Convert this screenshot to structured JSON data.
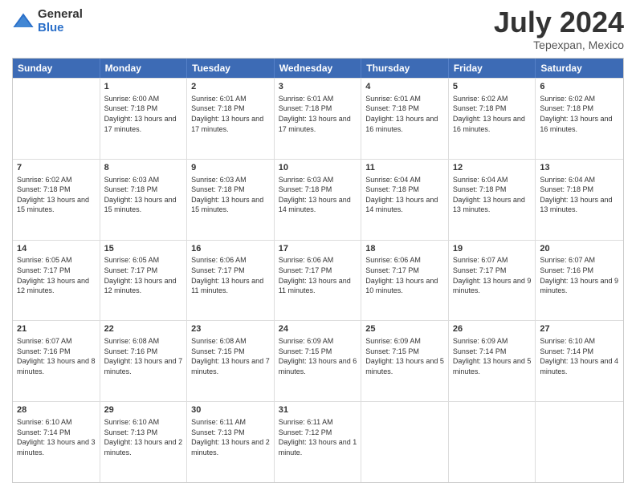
{
  "logo": {
    "general": "General",
    "blue": "Blue"
  },
  "title": "July 2024",
  "location": "Tepexpan, Mexico",
  "days_of_week": [
    "Sunday",
    "Monday",
    "Tuesday",
    "Wednesday",
    "Thursday",
    "Friday",
    "Saturday"
  ],
  "weeks": [
    [
      {
        "day": "",
        "sunrise": "",
        "sunset": "",
        "daylight": ""
      },
      {
        "day": "1",
        "sunrise": "Sunrise: 6:00 AM",
        "sunset": "Sunset: 7:18 PM",
        "daylight": "Daylight: 13 hours and 17 minutes."
      },
      {
        "day": "2",
        "sunrise": "Sunrise: 6:01 AM",
        "sunset": "Sunset: 7:18 PM",
        "daylight": "Daylight: 13 hours and 17 minutes."
      },
      {
        "day": "3",
        "sunrise": "Sunrise: 6:01 AM",
        "sunset": "Sunset: 7:18 PM",
        "daylight": "Daylight: 13 hours and 17 minutes."
      },
      {
        "day": "4",
        "sunrise": "Sunrise: 6:01 AM",
        "sunset": "Sunset: 7:18 PM",
        "daylight": "Daylight: 13 hours and 16 minutes."
      },
      {
        "day": "5",
        "sunrise": "Sunrise: 6:02 AM",
        "sunset": "Sunset: 7:18 PM",
        "daylight": "Daylight: 13 hours and 16 minutes."
      },
      {
        "day": "6",
        "sunrise": "Sunrise: 6:02 AM",
        "sunset": "Sunset: 7:18 PM",
        "daylight": "Daylight: 13 hours and 16 minutes."
      }
    ],
    [
      {
        "day": "7",
        "sunrise": "Sunrise: 6:02 AM",
        "sunset": "Sunset: 7:18 PM",
        "daylight": "Daylight: 13 hours and 15 minutes."
      },
      {
        "day": "8",
        "sunrise": "Sunrise: 6:03 AM",
        "sunset": "Sunset: 7:18 PM",
        "daylight": "Daylight: 13 hours and 15 minutes."
      },
      {
        "day": "9",
        "sunrise": "Sunrise: 6:03 AM",
        "sunset": "Sunset: 7:18 PM",
        "daylight": "Daylight: 13 hours and 15 minutes."
      },
      {
        "day": "10",
        "sunrise": "Sunrise: 6:03 AM",
        "sunset": "Sunset: 7:18 PM",
        "daylight": "Daylight: 13 hours and 14 minutes."
      },
      {
        "day": "11",
        "sunrise": "Sunrise: 6:04 AM",
        "sunset": "Sunset: 7:18 PM",
        "daylight": "Daylight: 13 hours and 14 minutes."
      },
      {
        "day": "12",
        "sunrise": "Sunrise: 6:04 AM",
        "sunset": "Sunset: 7:18 PM",
        "daylight": "Daylight: 13 hours and 13 minutes."
      },
      {
        "day": "13",
        "sunrise": "Sunrise: 6:04 AM",
        "sunset": "Sunset: 7:18 PM",
        "daylight": "Daylight: 13 hours and 13 minutes."
      }
    ],
    [
      {
        "day": "14",
        "sunrise": "Sunrise: 6:05 AM",
        "sunset": "Sunset: 7:17 PM",
        "daylight": "Daylight: 13 hours and 12 minutes."
      },
      {
        "day": "15",
        "sunrise": "Sunrise: 6:05 AM",
        "sunset": "Sunset: 7:17 PM",
        "daylight": "Daylight: 13 hours and 12 minutes."
      },
      {
        "day": "16",
        "sunrise": "Sunrise: 6:06 AM",
        "sunset": "Sunset: 7:17 PM",
        "daylight": "Daylight: 13 hours and 11 minutes."
      },
      {
        "day": "17",
        "sunrise": "Sunrise: 6:06 AM",
        "sunset": "Sunset: 7:17 PM",
        "daylight": "Daylight: 13 hours and 11 minutes."
      },
      {
        "day": "18",
        "sunrise": "Sunrise: 6:06 AM",
        "sunset": "Sunset: 7:17 PM",
        "daylight": "Daylight: 13 hours and 10 minutes."
      },
      {
        "day": "19",
        "sunrise": "Sunrise: 6:07 AM",
        "sunset": "Sunset: 7:17 PM",
        "daylight": "Daylight: 13 hours and 9 minutes."
      },
      {
        "day": "20",
        "sunrise": "Sunrise: 6:07 AM",
        "sunset": "Sunset: 7:16 PM",
        "daylight": "Daylight: 13 hours and 9 minutes."
      }
    ],
    [
      {
        "day": "21",
        "sunrise": "Sunrise: 6:07 AM",
        "sunset": "Sunset: 7:16 PM",
        "daylight": "Daylight: 13 hours and 8 minutes."
      },
      {
        "day": "22",
        "sunrise": "Sunrise: 6:08 AM",
        "sunset": "Sunset: 7:16 PM",
        "daylight": "Daylight: 13 hours and 7 minutes."
      },
      {
        "day": "23",
        "sunrise": "Sunrise: 6:08 AM",
        "sunset": "Sunset: 7:15 PM",
        "daylight": "Daylight: 13 hours and 7 minutes."
      },
      {
        "day": "24",
        "sunrise": "Sunrise: 6:09 AM",
        "sunset": "Sunset: 7:15 PM",
        "daylight": "Daylight: 13 hours and 6 minutes."
      },
      {
        "day": "25",
        "sunrise": "Sunrise: 6:09 AM",
        "sunset": "Sunset: 7:15 PM",
        "daylight": "Daylight: 13 hours and 5 minutes."
      },
      {
        "day": "26",
        "sunrise": "Sunrise: 6:09 AM",
        "sunset": "Sunset: 7:14 PM",
        "daylight": "Daylight: 13 hours and 5 minutes."
      },
      {
        "day": "27",
        "sunrise": "Sunrise: 6:10 AM",
        "sunset": "Sunset: 7:14 PM",
        "daylight": "Daylight: 13 hours and 4 minutes."
      }
    ],
    [
      {
        "day": "28",
        "sunrise": "Sunrise: 6:10 AM",
        "sunset": "Sunset: 7:14 PM",
        "daylight": "Daylight: 13 hours and 3 minutes."
      },
      {
        "day": "29",
        "sunrise": "Sunrise: 6:10 AM",
        "sunset": "Sunset: 7:13 PM",
        "daylight": "Daylight: 13 hours and 2 minutes."
      },
      {
        "day": "30",
        "sunrise": "Sunrise: 6:11 AM",
        "sunset": "Sunset: 7:13 PM",
        "daylight": "Daylight: 13 hours and 2 minutes."
      },
      {
        "day": "31",
        "sunrise": "Sunrise: 6:11 AM",
        "sunset": "Sunset: 7:12 PM",
        "daylight": "Daylight: 13 hours and 1 minute."
      },
      {
        "day": "",
        "sunrise": "",
        "sunset": "",
        "daylight": ""
      },
      {
        "day": "",
        "sunrise": "",
        "sunset": "",
        "daylight": ""
      },
      {
        "day": "",
        "sunrise": "",
        "sunset": "",
        "daylight": ""
      }
    ]
  ]
}
